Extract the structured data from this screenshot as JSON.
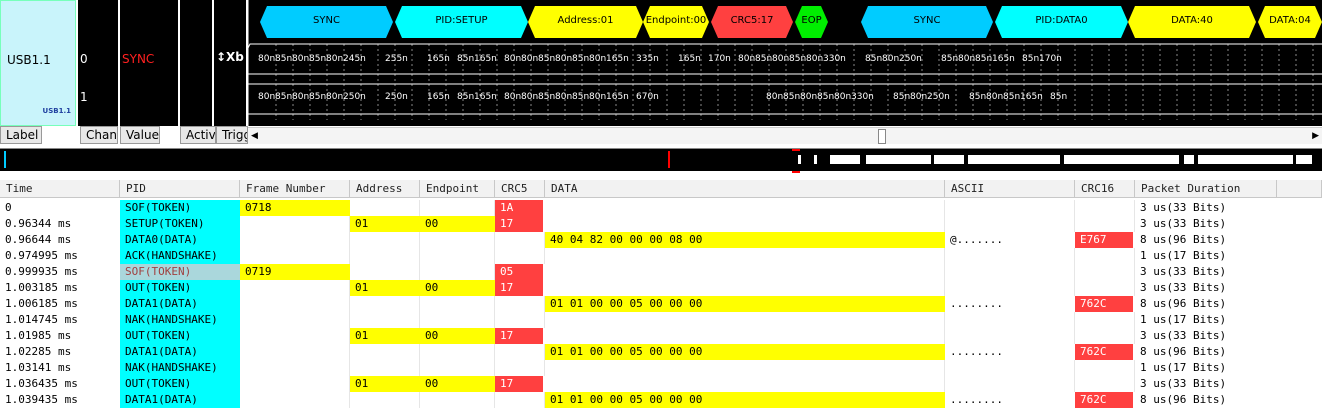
{
  "bus": {
    "name": "USB1.1",
    "small_label": "USB1.1"
  },
  "channels": [
    {
      "num": "0",
      "signal": "SYNC"
    },
    {
      "num": "1"
    }
  ],
  "xb_label": "↕Xb",
  "header_buttons": [
    {
      "label": "Label"
    },
    {
      "label": "Channel"
    },
    {
      "label": "Value"
    },
    {
      "label": "Activity"
    },
    {
      "label": "Trigger"
    }
  ],
  "decode_segments": [
    {
      "label": "SYNC",
      "color": "#00ccff"
    },
    {
      "label": "PID:SETUP",
      "color": "#00ffff"
    },
    {
      "label": "Address:01",
      "color": "#ffff00"
    },
    {
      "label": "Endpoint:00",
      "color": "#ffff00"
    },
    {
      "label": "CRC5:17",
      "color": "#ff4040"
    },
    {
      "label": "EOP",
      "color": "#00ee00"
    },
    {
      "label": "SYNC",
      "color": "#00ccff"
    },
    {
      "label": "PID:DATA0",
      "color": "#00ffff"
    },
    {
      "label": "DATA:40",
      "color": "#ffff00"
    },
    {
      "label": "DATA:04",
      "color": "#ffff00"
    }
  ],
  "timing_row0": [
    "80n",
    "85n",
    "80n",
    "85n",
    "80n",
    "245n",
    "255n",
    "165n",
    "85n",
    "165n",
    "80n",
    "80n",
    "85n",
    "80n",
    "85n",
    "80n",
    "165n",
    "335n",
    "165n",
    "170n",
    "80n",
    "85n",
    "80n",
    "85n",
    "80n",
    "330n",
    "85n",
    "80n",
    "250n",
    "85n",
    "80n",
    "85n",
    "165n",
    "85n",
    "170n"
  ],
  "timing_row1": [
    "80n",
    "85n",
    "80n",
    "85n",
    "80n",
    "250n",
    "250n",
    "165n",
    "85n",
    "165n",
    "80n",
    "80n",
    "85n",
    "80n",
    "85n",
    "80n",
    "165n",
    "670n",
    "80n",
    "85n",
    "80n",
    "85n",
    "80n",
    "330n",
    "85n",
    "80n",
    "250n",
    "85n",
    "80n",
    "85n",
    "165n",
    "85n"
  ],
  "table": {
    "columns": [
      "Time",
      "PID",
      "Frame Number",
      "Address",
      "Endpoint",
      "CRC5",
      "DATA",
      "ASCII",
      "CRC16",
      "Packet Duration"
    ],
    "rows": [
      {
        "time": "0",
        "pid": "SOF(TOKEN)",
        "frame": "0718",
        "address": "",
        "endpoint": "",
        "crc5": "1A",
        "data": "",
        "ascii": "",
        "crc16": "",
        "duration": "3 us(33 Bits)"
      },
      {
        "time": "0.96344 ms",
        "pid": "SETUP(TOKEN)",
        "frame": "",
        "address": "01",
        "endpoint": "00",
        "crc5": "17",
        "data": "",
        "ascii": "",
        "crc16": "",
        "duration": "3 us(33 Bits)"
      },
      {
        "time": "0.96644 ms",
        "pid": "DATA0(DATA)",
        "frame": "",
        "address": "",
        "endpoint": "",
        "crc5": "",
        "data": "40 04 82 00 00 00 08 00",
        "ascii": "@.......",
        "crc16": "E767",
        "duration": "8 us(96 Bits)"
      },
      {
        "time": "0.974995 ms",
        "pid": "ACK(HANDSHAKE)",
        "frame": "",
        "address": "",
        "endpoint": "",
        "crc5": "",
        "data": "",
        "ascii": "",
        "crc16": "",
        "duration": "1 us(17 Bits)"
      },
      {
        "time": "0.999935 ms",
        "pid": "SOF(TOKEN)",
        "frame": "0719",
        "address": "",
        "endpoint": "",
        "crc5": "05",
        "data": "",
        "ascii": "",
        "crc16": "",
        "duration": "3 us(33 Bits)"
      },
      {
        "time": "1.003185 ms",
        "pid": "OUT(TOKEN)",
        "frame": "",
        "address": "01",
        "endpoint": "00",
        "crc5": "17",
        "data": "",
        "ascii": "",
        "crc16": "",
        "duration": "3 us(33 Bits)"
      },
      {
        "time": "1.006185 ms",
        "pid": "DATA1(DATA)",
        "frame": "",
        "address": "",
        "endpoint": "",
        "crc5": "",
        "data": "01 01 00 00 05 00 00 00",
        "ascii": "........",
        "crc16": "762C",
        "duration": "8 us(96 Bits)"
      },
      {
        "time": "1.014745 ms",
        "pid": "NAK(HANDSHAKE)",
        "frame": "",
        "address": "",
        "endpoint": "",
        "crc5": "",
        "data": "",
        "ascii": "",
        "crc16": "",
        "duration": "1 us(17 Bits)"
      },
      {
        "time": "1.01985 ms",
        "pid": "OUT(TOKEN)",
        "frame": "",
        "address": "01",
        "endpoint": "00",
        "crc5": "17",
        "data": "",
        "ascii": "",
        "crc16": "",
        "duration": "3 us(33 Bits)"
      },
      {
        "time": "1.02285 ms",
        "pid": "DATA1(DATA)",
        "frame": "",
        "address": "",
        "endpoint": "",
        "crc5": "",
        "data": "01 01 00 00 05 00 00 00",
        "ascii": "........",
        "crc16": "762C",
        "duration": "8 us(96 Bits)"
      },
      {
        "time": "1.03141 ms",
        "pid": "NAK(HANDSHAKE)",
        "frame": "",
        "address": "",
        "endpoint": "",
        "crc5": "",
        "data": "",
        "ascii": "",
        "crc16": "",
        "duration": "1 us(17 Bits)"
      },
      {
        "time": "1.036435 ms",
        "pid": "OUT(TOKEN)",
        "frame": "",
        "address": "01",
        "endpoint": "00",
        "crc5": "17",
        "data": "",
        "ascii": "",
        "crc16": "",
        "duration": "3 us(33 Bits)"
      },
      {
        "time": "1.039435 ms",
        "pid": "DATA1(DATA)",
        "frame": "",
        "address": "",
        "endpoint": "",
        "crc5": "",
        "data": "01 01 00 00 05 00 00 00",
        "ascii": "........",
        "crc16": "762C",
        "duration": "8 us(96 Bits)"
      }
    ]
  }
}
